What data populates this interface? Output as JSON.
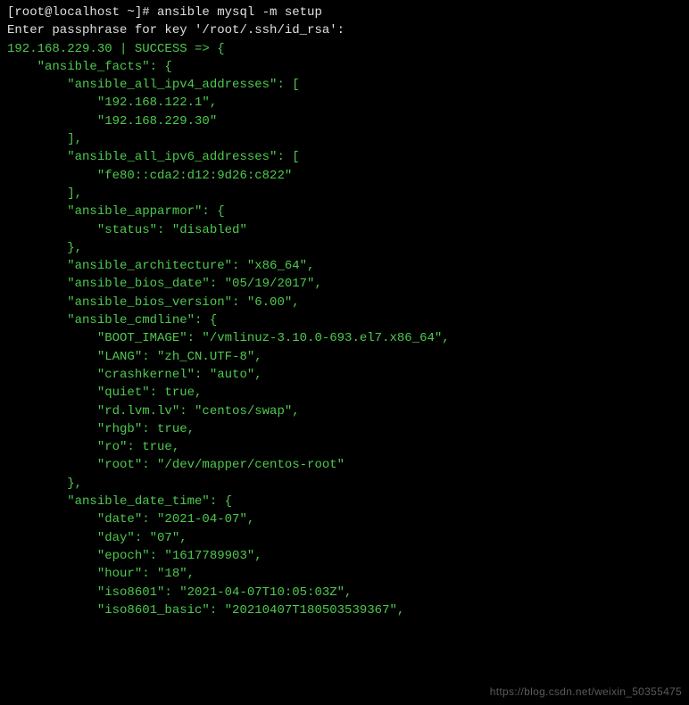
{
  "prompt": "[root@localhost ~]# ansible mysql -m setup",
  "passphrase_prompt": "Enter passphrase for key '/root/.ssh/id_rsa':",
  "result_header": "192.168.229.30 | SUCCESS => {",
  "lines": [
    "    \"ansible_facts\": {",
    "        \"ansible_all_ipv4_addresses\": [",
    "            \"192.168.122.1\",",
    "            \"192.168.229.30\"",
    "        ],",
    "        \"ansible_all_ipv6_addresses\": [",
    "            \"fe80::cda2:d12:9d26:c822\"",
    "        ],",
    "        \"ansible_apparmor\": {",
    "            \"status\": \"disabled\"",
    "        },",
    "        \"ansible_architecture\": \"x86_64\",",
    "        \"ansible_bios_date\": \"05/19/2017\",",
    "        \"ansible_bios_version\": \"6.00\",",
    "        \"ansible_cmdline\": {",
    "            \"BOOT_IMAGE\": \"/vmlinuz-3.10.0-693.el7.x86_64\",",
    "            \"LANG\": \"zh_CN.UTF-8\",",
    "            \"crashkernel\": \"auto\",",
    "            \"quiet\": true,",
    "            \"rd.lvm.lv\": \"centos/swap\",",
    "            \"rhgb\": true,",
    "            \"ro\": true,",
    "            \"root\": \"/dev/mapper/centos-root\"",
    "        },",
    "        \"ansible_date_time\": {",
    "            \"date\": \"2021-04-07\",",
    "            \"day\": \"07\",",
    "            \"epoch\": \"1617789903\",",
    "            \"hour\": \"18\",",
    "            \"iso8601\": \"2021-04-07T10:05:03Z\",",
    "            \"iso8601_basic\": \"20210407T180503539367\","
  ],
  "watermark": "https://blog.csdn.net/weixin_50355475"
}
